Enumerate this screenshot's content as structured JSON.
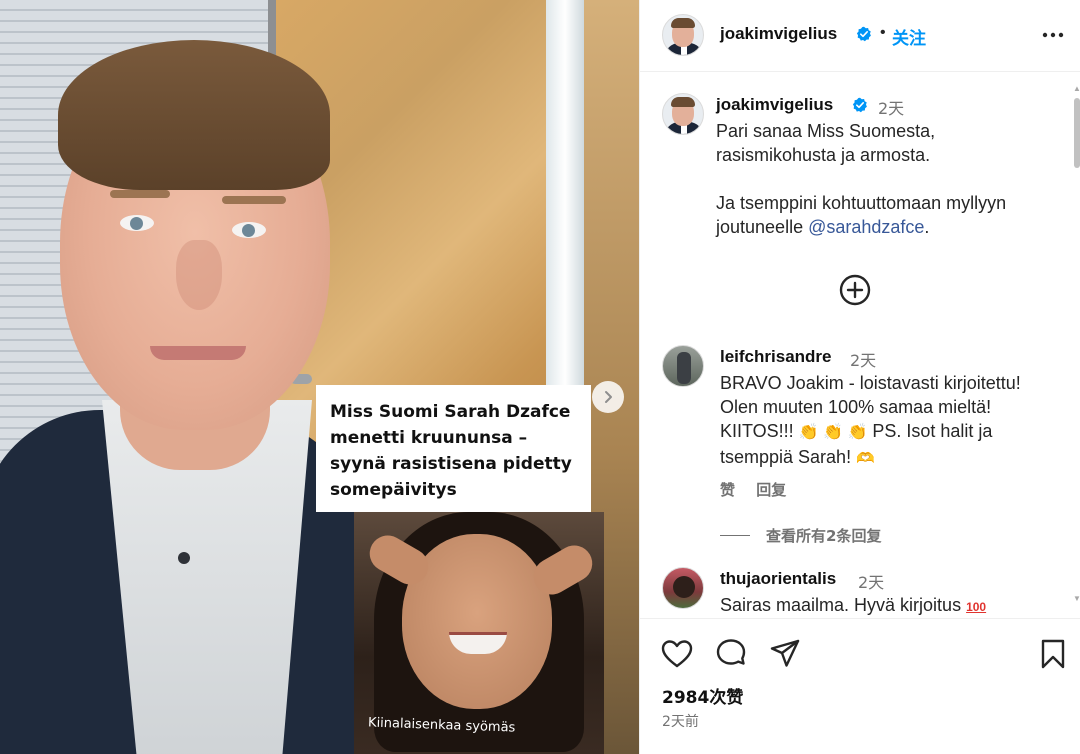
{
  "post": {
    "media": {
      "headline": "Miss Suomi Sarah Dzafce menetti kruununsa – syynä rasistisena pidetty somepäivitys",
      "video_caption": "Kiinalaisenkaa syömäs"
    },
    "header": {
      "username": "joakimvigelius",
      "separator": "•",
      "follow_label": "关注"
    },
    "caption": {
      "username": "joakimvigelius",
      "time": "2天",
      "text": "Pari sanaa Miss Suomesta,\nrasismikohusta ja armosta.\n\nJa tsemppini kohtuuttomaan myllyyn joutuneelle ",
      "mention": "@sarahdzafce",
      "trailing": "."
    },
    "comments": [
      {
        "username": "leifchrisandre",
        "time": "2天",
        "text_before": "BRAVO Joakim - loistavasti kirjoitettu! Olen muuten 100% samaa mieltä! KIITOS!!! ",
        "text_after": " PS. Isot halit ja tsemppiä Sarah! ",
        "like_label": "赞",
        "reply_label": "回复",
        "view_replies": "查看所有2条回复"
      },
      {
        "username": "thujaorientalis",
        "time": "2天",
        "text": "Sairas maailma. Hyvä kirjoitus "
      }
    ],
    "likes": "2984次赞",
    "posted": "2天前"
  },
  "icons": {
    "verified": "verified-badge-icon",
    "more": "more-options-icon",
    "load_more": "plus-circle-icon",
    "like": "heart-icon",
    "comment": "comment-bubble-icon",
    "share": "share-paper-plane-icon",
    "save": "bookmark-icon",
    "next": "chevron-right-icon"
  },
  "colors": {
    "accent": "#0095f6",
    "mention": "#385898",
    "muted": "#737373"
  }
}
